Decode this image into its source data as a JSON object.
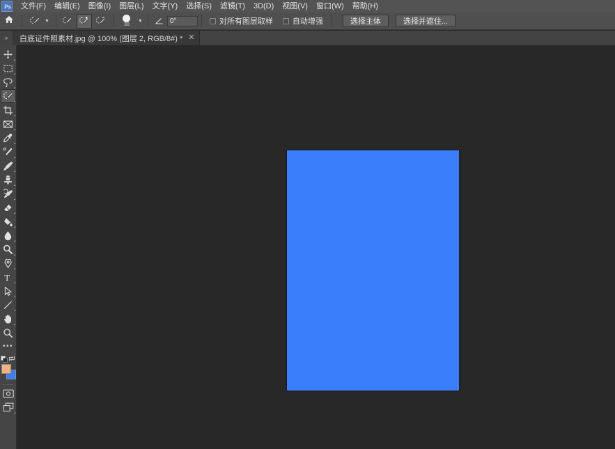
{
  "app": {
    "name": "Adobe Photoshop",
    "icon": "photoshop-app-icon"
  },
  "menubar": {
    "items": [
      {
        "label": "文件(F)",
        "name": "menu-file"
      },
      {
        "label": "编辑(E)",
        "name": "menu-edit"
      },
      {
        "label": "图像(I)",
        "name": "menu-image"
      },
      {
        "label": "图层(L)",
        "name": "menu-layer"
      },
      {
        "label": "文字(Y)",
        "name": "menu-type"
      },
      {
        "label": "选择(S)",
        "name": "menu-select"
      },
      {
        "label": "滤镜(T)",
        "name": "menu-filter"
      },
      {
        "label": "3D(D)",
        "name": "menu-3d"
      },
      {
        "label": "视图(V)",
        "name": "menu-view"
      },
      {
        "label": "窗口(W)",
        "name": "menu-window"
      },
      {
        "label": "帮助(H)",
        "name": "menu-help"
      }
    ]
  },
  "options_bar": {
    "home_icon": "home-icon",
    "tool_preset_icon": "quick-selection-tool-icon",
    "tool_preset_chevron": "chevron-down-icon",
    "selection_modes": [
      {
        "name": "new-selection-mode",
        "icon": "quick-selection-new-icon",
        "active": false
      },
      {
        "name": "add-to-selection-mode",
        "icon": "quick-selection-add-icon",
        "active": true
      },
      {
        "name": "subtract-from-selection-mode",
        "icon": "quick-selection-subtract-icon",
        "active": false
      }
    ],
    "brush_size": "30",
    "brush_chevron": "chevron-down-icon",
    "angle_icon": "angle-icon",
    "angle_value": "0°",
    "checkbox_sample_all_layers": {
      "label": "对所有图层取样",
      "checked": false
    },
    "checkbox_auto_enhance": {
      "label": "自动增强",
      "checked": false
    },
    "select_subject_label": "选择主体",
    "select_and_mask_label": "选择并遮住..."
  },
  "tabbar": {
    "collapse_icon": "chevron-double-right-icon",
    "document": {
      "title": "白底证件照素材.jpg @ 100% (图层 2, RGB/8#) *",
      "close_icon": "close-icon"
    }
  },
  "toolbar": {
    "tools": [
      {
        "name": "move-tool",
        "icon": "move-icon",
        "has_corner": true,
        "active": false
      },
      {
        "name": "rectangular-marquee-tool",
        "icon": "marquee-icon",
        "has_corner": true,
        "active": false
      },
      {
        "name": "lasso-tool",
        "icon": "lasso-icon",
        "has_corner": true,
        "active": false
      },
      {
        "name": "quick-selection-tool",
        "icon": "quick-selection-icon",
        "has_corner": true,
        "active": true
      },
      {
        "name": "crop-tool",
        "icon": "crop-icon",
        "has_corner": true,
        "active": false
      },
      {
        "name": "frame-tool",
        "icon": "frame-icon",
        "has_corner": true,
        "active": false
      },
      {
        "name": "eyedropper-tool",
        "icon": "eyedropper-icon",
        "has_corner": true,
        "active": false
      },
      {
        "name": "spot-healing-brush-tool",
        "icon": "healing-brush-icon",
        "has_corner": true,
        "active": false
      },
      {
        "name": "brush-tool",
        "icon": "brush-icon",
        "has_corner": true,
        "active": false
      },
      {
        "name": "clone-stamp-tool",
        "icon": "clone-stamp-icon",
        "has_corner": true,
        "active": false
      },
      {
        "name": "history-brush-tool",
        "icon": "history-brush-icon",
        "has_corner": true,
        "active": false
      },
      {
        "name": "eraser-tool",
        "icon": "eraser-icon",
        "has_corner": true,
        "active": false
      },
      {
        "name": "gradient-tool",
        "icon": "paint-bucket-icon",
        "has_corner": true,
        "active": false
      },
      {
        "name": "blur-tool",
        "icon": "blur-droplet-icon",
        "has_corner": true,
        "active": false
      },
      {
        "name": "dodge-tool",
        "icon": "dodge-icon",
        "has_corner": true,
        "active": false
      },
      {
        "name": "pen-tool",
        "icon": "pen-icon",
        "has_corner": true,
        "active": false
      },
      {
        "name": "type-tool",
        "icon": "type-icon",
        "has_corner": true,
        "active": false
      },
      {
        "name": "path-selection-tool",
        "icon": "path-arrow-icon",
        "has_corner": true,
        "active": false
      },
      {
        "name": "line-tool",
        "icon": "line-icon",
        "has_corner": true,
        "active": false
      },
      {
        "name": "hand-tool",
        "icon": "hand-icon",
        "has_corner": true,
        "active": false
      },
      {
        "name": "zoom-tool",
        "icon": "magnifier-icon",
        "has_corner": false,
        "active": false
      }
    ],
    "edit_toolbar_icon": "ellipsis-icon",
    "default_colors_icon": "default-colors-icon",
    "swap_colors_icon": "swap-colors-icon",
    "foreground_color": "#f0b27e",
    "background_color": "#3b7efb",
    "quick_mask_icon": "quick-mask-icon",
    "screen_mode_icon": "screen-mode-icon"
  },
  "canvas": {
    "background_color": "#282828",
    "document_fill_color": "#3b7efb",
    "document_width": 247,
    "document_height": 345
  }
}
